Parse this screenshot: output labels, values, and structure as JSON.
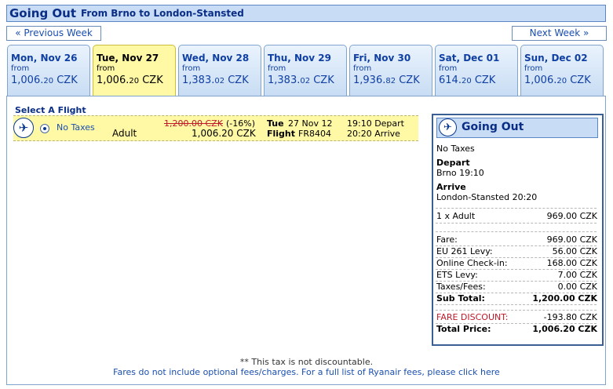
{
  "header": {
    "title": "Going Out",
    "route": "From Brno to London-Stansted"
  },
  "nav": {
    "prev": "« Previous Week",
    "next": "Next Week »"
  },
  "days": [
    {
      "name": "Mon, Nov 26",
      "from": "from",
      "price_int": "1,006.",
      "price_dec": "20",
      "currency": "CZK"
    },
    {
      "name": "Tue, Nov 27",
      "from": "from",
      "price_int": "1,006.",
      "price_dec": "20",
      "currency": "CZK"
    },
    {
      "name": "Wed, Nov 28",
      "from": "from",
      "price_int": "1,383.",
      "price_dec": "02",
      "currency": "CZK"
    },
    {
      "name": "Thu, Nov 29",
      "from": "from",
      "price_int": "1,383.",
      "price_dec": "02",
      "currency": "CZK"
    },
    {
      "name": "Fri, Nov 30",
      "from": "from",
      "price_int": "1,936.",
      "price_dec": "82",
      "currency": "CZK"
    },
    {
      "name": "Sat, Dec 01",
      "from": "from",
      "price_int": "614.",
      "price_dec": "20",
      "currency": "CZK"
    },
    {
      "name": "Sun, Dec 02",
      "from": "from",
      "price_int": "1,006.",
      "price_dec": "20",
      "currency": "CZK"
    }
  ],
  "selected_day_index": 1,
  "flight": {
    "section_title": "Select A Flight",
    "fare_type": "No Taxes",
    "passenger": "Adult",
    "old_price": "1,200.00 CZK",
    "discount": "(-16%)",
    "price": "1,006.20 CZK",
    "day": "Tue",
    "date": "27 Nov 12",
    "flight_label": "Flight",
    "flight_no": "FR8404",
    "depart_time": "19:10 Depart",
    "arrive_time": "20:20 Arrive"
  },
  "summary": {
    "title": "Going Out",
    "fare_type": "No Taxes",
    "depart_label": "Depart",
    "depart_value": "Brno 19:10",
    "arrive_label": "Arrive",
    "arrive_value": "London-Stansted 20:20",
    "pax_label": "1 x Adult",
    "pax_value": "969.00 CZK",
    "lines": [
      {
        "label": "Fare:",
        "value": "969.00 CZK"
      },
      {
        "label": "EU 261 Levy:",
        "value": "56.00 CZK"
      },
      {
        "label": "Online Check-in:",
        "value": "168.00 CZK"
      },
      {
        "label": "ETS Levy:",
        "value": "7.00 CZK"
      },
      {
        "label": "Taxes/Fees:",
        "value": "0.00 CZK"
      }
    ],
    "subtotal_label": "Sub Total:",
    "subtotal_value": "1,200.00 CZK",
    "discount_label": "FARE DISCOUNT:",
    "discount_value": "-193.80 CZK",
    "total_label": "Total Price:",
    "total_value": "1,006.20 CZK"
  },
  "footer": {
    "note": "** This tax is not discountable.",
    "fees": "Fares do not include optional fees/charges. For a full list of Ryanair fees, please click here"
  },
  "colors": {
    "accent": "#0a2e86",
    "selected_tab": "#fff9a6",
    "discount_red": "#c0182a"
  },
  "icons": {
    "flight": "airplane-icon",
    "radio": "radio-selected"
  }
}
